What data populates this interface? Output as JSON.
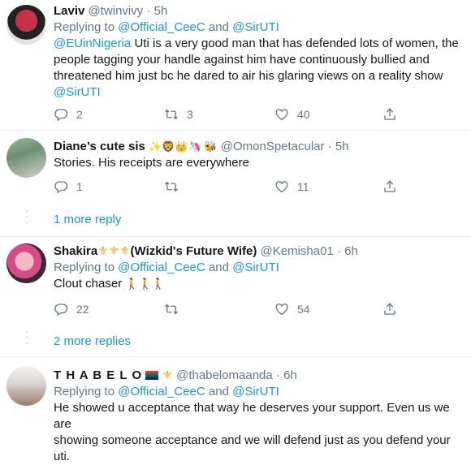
{
  "tweets": [
    {
      "name": "Laviv",
      "handle": "@twinvivy",
      "time": "· 5h",
      "replying_prefix": "Replying to",
      "replying_user1": "@Official_CeeC",
      "replying_and": "and",
      "replying_user2": "@SirUTI",
      "mention": "@EUinNigeria",
      "text": "Uti is a very good man that has defended lots of women, the people tagging your handle against him have continuously bullied and threatened him just bc he dared to air his glaring views on a reality show",
      "mention_end": "@SirUTI",
      "replies": "2",
      "retweets": "3",
      "likes": "40"
    },
    {
      "name": "Diane’s cute sis",
      "handle": "@OmonSpetacular",
      "time": "· 5h",
      "text": "Stories. His receipts are everywhere",
      "replies": "1",
      "retweets": "",
      "likes": "11",
      "more": "1 more reply"
    },
    {
      "name_prefix": "Shakira",
      "name_suffix": "(Wizkid's Future Wife)",
      "handle": "@Kemisha01",
      "time": "· 6h",
      "replying_prefix": "Replying to",
      "replying_user1": "@Official_CeeC",
      "replying_and": "and",
      "replying_user2": "@SirUTI",
      "text": "Clout chaser",
      "replies": "22",
      "retweets": "",
      "likes": "54",
      "more": "2 more replies"
    },
    {
      "name": "T H A B E L O",
      "handle": "@thabelomaanda",
      "time": "· 6h",
      "replying_prefix": "Replying to",
      "replying_user1": "@Official_CeeC",
      "replying_and": "and",
      "replying_user2": "@SirUTI",
      "text_line1": "He showed u acceptance that way he deserves your support. Even us we are",
      "text_line2": "showing someone acceptance and we will defend just as you defend your",
      "text_line3": "uti."
    }
  ],
  "icons": {
    "reply": "reply-icon",
    "retweet": "retweet-icon",
    "like": "heart-icon",
    "share": "share-icon"
  },
  "colors": {
    "link": "#1b95e0",
    "muted": "#657786",
    "border": "#e6ecf0"
  }
}
